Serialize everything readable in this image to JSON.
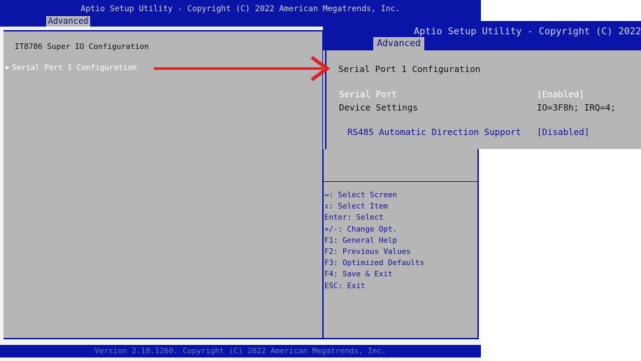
{
  "main_window": {
    "header_title": "Aptio Setup Utility - Copyright (C) 2022 American Megatrends, Inc.",
    "tab_label": "Advanced",
    "section_title": "IT8786 Super IO Configuration",
    "submenu_label": "Serial Port 1 Configuration",
    "help_items": [
      "↔: Select Screen",
      "↕: Select Item",
      "Enter: Select",
      "+/-: Change Opt.",
      "F1: General Help",
      "F2: Previous Values",
      "F3: Optimized Defaults",
      "F4: Save & Exit",
      "ESC: Exit"
    ],
    "footer": "Version 2.18.1260. Copyright (C) 2022 American Megatrends, Inc."
  },
  "zoom_window": {
    "header_title": "Aptio Setup Utility - Copyright (C) 2022 A",
    "tab_label": "Advanced",
    "page_title": "Serial Port 1 Configuration",
    "serial_port_label": "Serial Port",
    "serial_port_value": "[Enabled]",
    "device_settings_label": "Device Settings",
    "device_settings_value": "IO=3F8h; IRQ=4;",
    "rs485_label": "RS485 Automatic Direction Support",
    "rs485_value": "[Disabled]"
  },
  "colors": {
    "header_blue": "#0a14a6",
    "panel_gray": "#b6b6b6",
    "help_text_blue": "#12129a",
    "annotation_red": "#e02020"
  }
}
